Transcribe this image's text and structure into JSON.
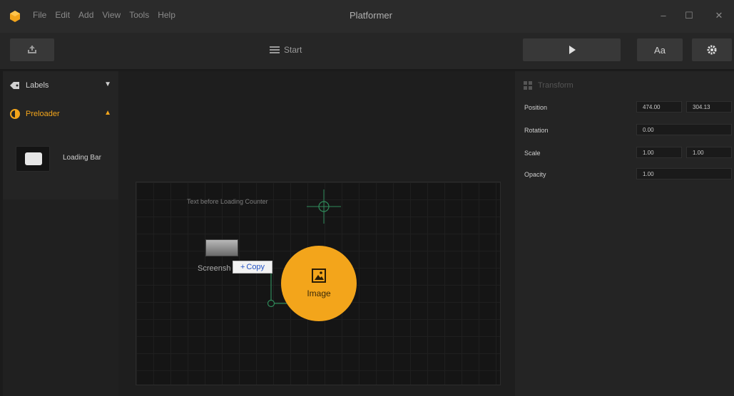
{
  "app": {
    "title": "Platformer"
  },
  "menu": [
    "File",
    "Edit",
    "Add",
    "View",
    "Tools",
    "Help"
  ],
  "window_controls": {
    "minimize": "–",
    "maximize": "☐",
    "close": "✕"
  },
  "toolbar": {
    "start_label": "Start",
    "text_button_label": "Aa"
  },
  "left_panel": {
    "labels_header": "Labels",
    "preloader_header": "Preloader",
    "item_label": "Loading Bar"
  },
  "scene": {
    "text_object_label": "Text before Loading Counter",
    "screenshot_label": "Screensh",
    "copy_badge": "Copy",
    "image_node_label": "Image"
  },
  "properties": {
    "header": "Transform",
    "position_label": "Position",
    "position_x": "474.00",
    "position_y": "304.13",
    "rotation_label": "Rotation",
    "rotation": "0.00",
    "scale_label": "Scale",
    "scale_x": "1.00",
    "scale_y": "1.00",
    "opacity_label": "Opacity",
    "opacity": "1.00"
  },
  "colors": {
    "accent": "#f3a51b",
    "background": "#1b1b1b",
    "panel": "#242424"
  }
}
